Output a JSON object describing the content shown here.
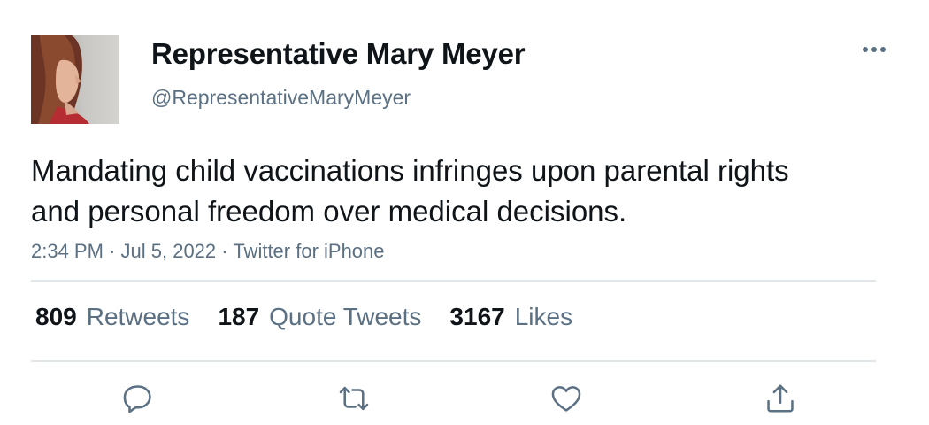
{
  "author": {
    "display_name": "Representative Mary Meyer",
    "handle": "@RepresentativeMaryMeyer"
  },
  "tweet": {
    "text": "Mandating child vaccinations infringes upon parental rights and personal freedom over medical decisions.",
    "time": "2:34 PM",
    "date": "Jul 5, 2022",
    "source": "Twitter for iPhone",
    "separator": "·"
  },
  "stats": {
    "retweets": {
      "count": "809",
      "label": "Retweets"
    },
    "quote_tweets": {
      "count": "187",
      "label": "Quote Tweets"
    },
    "likes": {
      "count": "3167",
      "label": "Likes"
    }
  },
  "actions": [
    {
      "name": "reply",
      "icon": "reply-icon"
    },
    {
      "name": "retweet",
      "icon": "retweet-icon"
    },
    {
      "name": "like",
      "icon": "heart-icon"
    },
    {
      "name": "share",
      "icon": "share-icon"
    }
  ],
  "colors": {
    "text_primary": "#0f1419",
    "text_secondary": "#5b7083",
    "divider": "#e1e6ea"
  }
}
